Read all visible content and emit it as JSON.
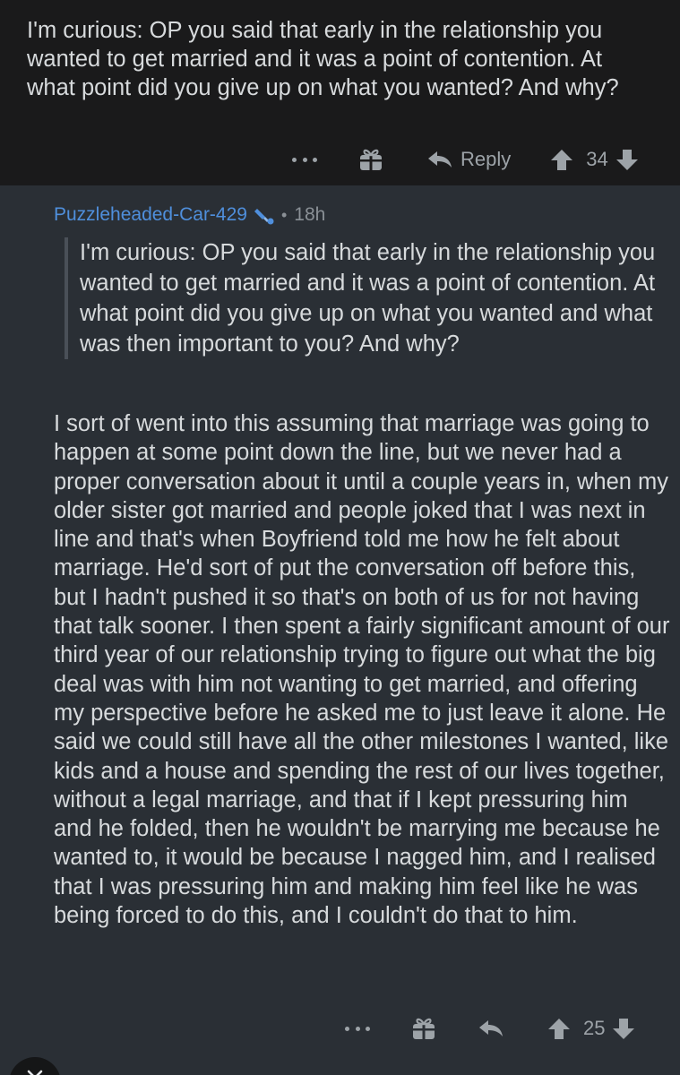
{
  "parent": {
    "body": "I'm curious: OP you said that early in the relationship you wanted to get married and it was a point of contention. At what point did you give up on what you wanted? And why?",
    "reply_label": "Reply",
    "score": "34"
  },
  "child": {
    "author": "Puzzleheaded-Car-429",
    "separator": "•",
    "time": "18h",
    "quote": "I'm curious: OP you said that early in the relationship you wanted to get married and it was a point of contention. At what point did you give up on what you wanted and what was then important to you? And why?",
    "body": "I sort of went into this assuming that marriage was going to happen at some point down the line, but we never had a proper conversation about it until a couple years in, when my older sister got married and people joked that I was next in line and that's when Boyfriend told me how he felt about marriage. He'd sort of put the conversation off before this, but I hadn't pushed it so that's on both of us for not having that talk sooner. I then spent a fairly significant amount of our third year of our relationship trying to figure out what the big deal was with him not wanting to get married, and offering my perspective before he asked me to just leave it alone. He said we could still have all the other milestones I wanted, like kids and a house and spending the rest of our lives together, without a legal marriage, and that if I kept pressuring him and he folded, then he wouldn't be marrying me because he wanted to, it would be because I nagged him, and I realised that I was pressuring him and making him feel like he was being forced to do this, and I couldn't do that to him.",
    "score": "25"
  },
  "colors": {
    "parent_bg": "#1a1a1b",
    "child_bg": "#2a2f35",
    "author": "#4f8fdc",
    "muted": "#9da3a8"
  },
  "icons": [
    "more-icon",
    "gift-icon",
    "reply-icon",
    "upvote-icon",
    "downvote-icon",
    "flair-icon",
    "close-icon"
  ]
}
